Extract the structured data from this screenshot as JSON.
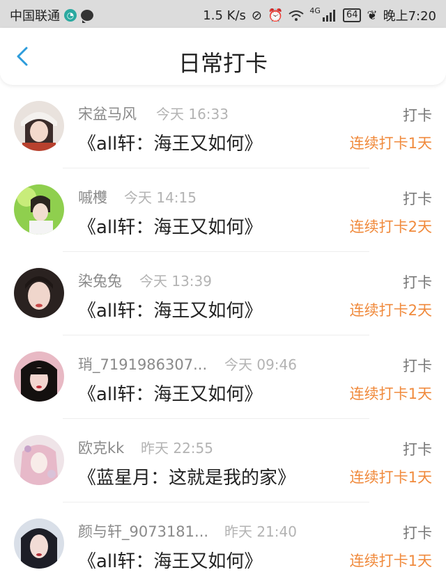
{
  "status_bar": {
    "carrier": "中国联通",
    "speed": "1.5 K/s",
    "network": "4G",
    "battery": "64",
    "time": "晚上7:20"
  },
  "header": {
    "title": "日常打卡"
  },
  "list": [
    {
      "name": "宋盆马风",
      "time": "今天 16:33",
      "book": "《all轩：海王又如何》",
      "kind": "打卡",
      "streak": "连续打卡1天"
    },
    {
      "name": "嘁欆",
      "time": "今天 14:15",
      "book": "《all轩：海王又如何》",
      "kind": "打卡",
      "streak": "连续打卡2天"
    },
    {
      "name": "染兔兔",
      "time": "今天 13:39",
      "book": "《all轩：海王又如何》",
      "kind": "打卡",
      "streak": "连续打卡2天"
    },
    {
      "name": "琑_7191986307...",
      "time": "今天 09:46",
      "book": "《all轩：海王又如何》",
      "kind": "打卡",
      "streak": "连续打卡1天"
    },
    {
      "name": "欧克kk",
      "time": "昨天 22:55",
      "book": "《蓝星月：这就是我的家》",
      "kind": "打卡",
      "streak": "连续打卡1天"
    },
    {
      "name": "颜与轩_9073181...",
      "time": "昨天 21:40",
      "book": "《all轩：海王又如何》",
      "kind": "打卡",
      "streak": "连续打卡1天"
    }
  ],
  "colors": {
    "accent": "#f08a3c",
    "back": "#2d9cdb"
  }
}
